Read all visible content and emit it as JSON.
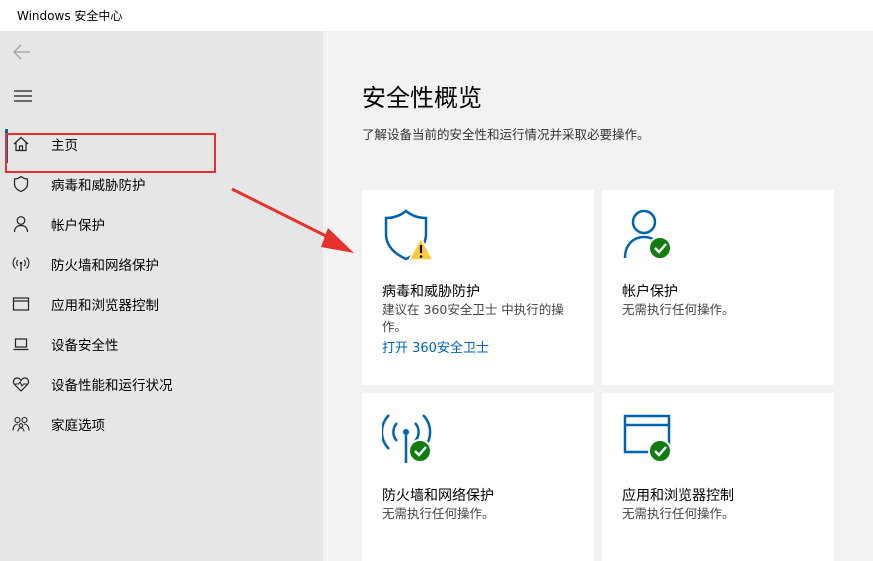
{
  "window": {
    "title": "Windows 安全中心"
  },
  "sidebar": {
    "back_icon": "back-arrow-icon",
    "menu_icon": "hamburger-icon",
    "items": [
      {
        "label": "主页",
        "icon": "home-icon"
      },
      {
        "label": "病毒和威胁防护",
        "icon": "shield-icon"
      },
      {
        "label": "帐户保护",
        "icon": "person-icon"
      },
      {
        "label": "防火墙和网络保护",
        "icon": "wireless-icon"
      },
      {
        "label": "应用和浏览器控制",
        "icon": "browser-window-icon"
      },
      {
        "label": "设备安全性",
        "icon": "laptop-icon"
      },
      {
        "label": "设备性能和运行状况",
        "icon": "heart-icon"
      },
      {
        "label": "家庭选项",
        "icon": "family-icon"
      }
    ]
  },
  "main": {
    "title": "安全性概览",
    "subtitle": "了解设备当前的安全性和运行情况并采取必要操作。",
    "cards": [
      {
        "title": "病毒和威胁防护",
        "desc": "建议在 360安全卫士 中执行的操作。",
        "link": "打开 360安全卫士",
        "status": "warning"
      },
      {
        "title": "帐户保护",
        "desc": "无需执行任何操作。",
        "status": "ok"
      },
      {
        "title": "防火墙和网络保护",
        "desc": "无需执行任何操作。",
        "status": "ok"
      },
      {
        "title": "应用和浏览器控制",
        "desc": "无需执行任何操作。",
        "status": "ok"
      }
    ]
  },
  "colors": {
    "accent": "#0063b1",
    "warning": "#ffc83d",
    "ok": "#107c10",
    "annotation": "#e5322d"
  }
}
